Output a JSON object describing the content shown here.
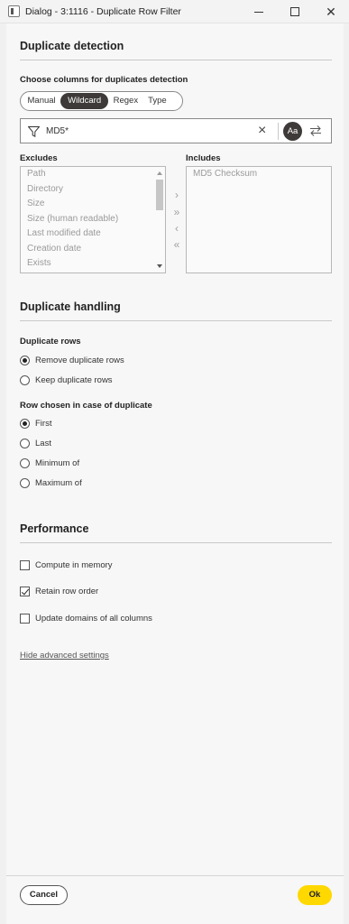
{
  "window": {
    "title": "Dialog - 3:1116 - Duplicate Row Filter"
  },
  "sections": {
    "detection": "Duplicate detection",
    "handling": "Duplicate handling",
    "performance": "Performance"
  },
  "detection": {
    "columns_label": "Choose columns for duplicates detection",
    "modes": [
      "Manual",
      "Wildcard",
      "Regex",
      "Type"
    ],
    "active_mode": "Wildcard",
    "filter_value": "MD5*",
    "case_label": "Aa",
    "excludes_label": "Excludes",
    "includes_label": "Includes",
    "excludes": [
      "Path",
      "Directory",
      "Size",
      "Size (human readable)",
      "Last modified date",
      "Creation date",
      "Exists"
    ],
    "includes": [
      "MD5 Checksum"
    ],
    "move_buttons": [
      "›",
      "»",
      "‹",
      "«"
    ]
  },
  "handling": {
    "dup_rows_label": "Duplicate rows",
    "dup_rows_options": [
      "Remove duplicate rows",
      "Keep duplicate rows"
    ],
    "dup_rows_selected": "Remove duplicate rows",
    "row_chosen_label": "Row chosen in case of duplicate",
    "row_chosen_options": [
      "First",
      "Last",
      "Minimum of",
      "Maximum of"
    ],
    "row_chosen_selected": "First"
  },
  "performance": {
    "options": [
      {
        "label": "Compute in memory",
        "checked": false
      },
      {
        "label": "Retain row order",
        "checked": true
      },
      {
        "label": "Update domains of all columns",
        "checked": false
      }
    ]
  },
  "advanced_link": "Hide advanced settings",
  "footer": {
    "cancel": "Cancel",
    "ok": "Ok"
  },
  "colors": {
    "ok_button": "#ffd800",
    "active_segment": "#3e3a39"
  }
}
